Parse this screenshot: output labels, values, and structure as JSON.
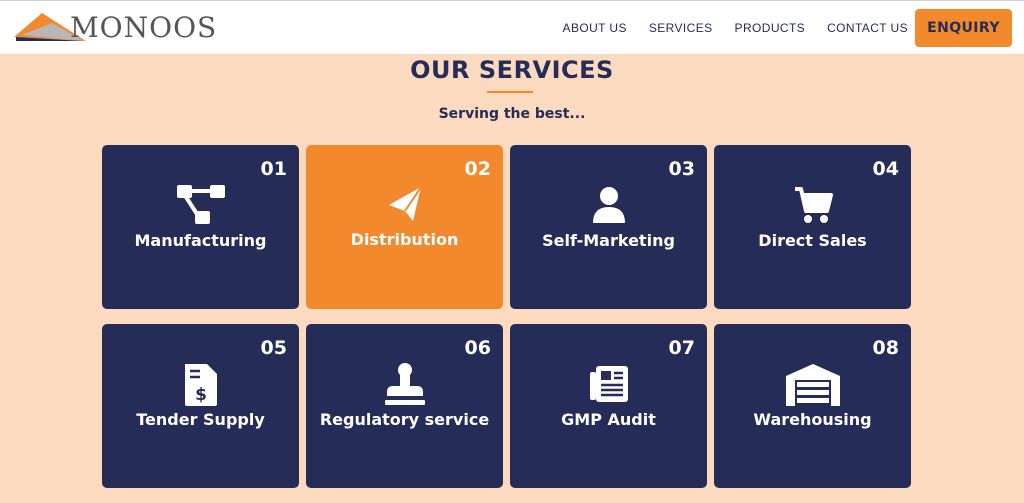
{
  "brand": {
    "name": "MONOOS",
    "icon": "logo-wing-mark"
  },
  "nav": {
    "items": [
      {
        "label": "ABOUT US"
      },
      {
        "label": "SERVICES"
      },
      {
        "label": "PRODUCTS"
      },
      {
        "label": "CONTACT US"
      }
    ],
    "cta_label": "ENQUIRY"
  },
  "services": {
    "title": "OUR SERVICES",
    "subtitle": "Serving the best...",
    "cards": [
      {
        "number": "01",
        "label": "Manufacturing",
        "icon": "process-flow-icon"
      },
      {
        "number": "02",
        "label": "Distribution",
        "icon": "paper-plane-icon",
        "active": true
      },
      {
        "number": "03",
        "label": "Self-Marketing",
        "icon": "user-icon"
      },
      {
        "number": "04",
        "label": "Direct Sales",
        "icon": "shopping-cart-icon"
      },
      {
        "number": "05",
        "label": "Tender Supply",
        "icon": "invoice-dollar-icon"
      },
      {
        "number": "06",
        "label": "Regulatory service",
        "icon": "stamp-icon"
      },
      {
        "number": "07",
        "label": "GMP Audit",
        "icon": "newspaper-icon"
      },
      {
        "number": "08",
        "label": "Warehousing",
        "icon": "warehouse-icon"
      }
    ]
  },
  "colors": {
    "navy": "#252c57",
    "orange": "#f28a2d",
    "background": "#fbdabf",
    "white": "#ffffff"
  }
}
